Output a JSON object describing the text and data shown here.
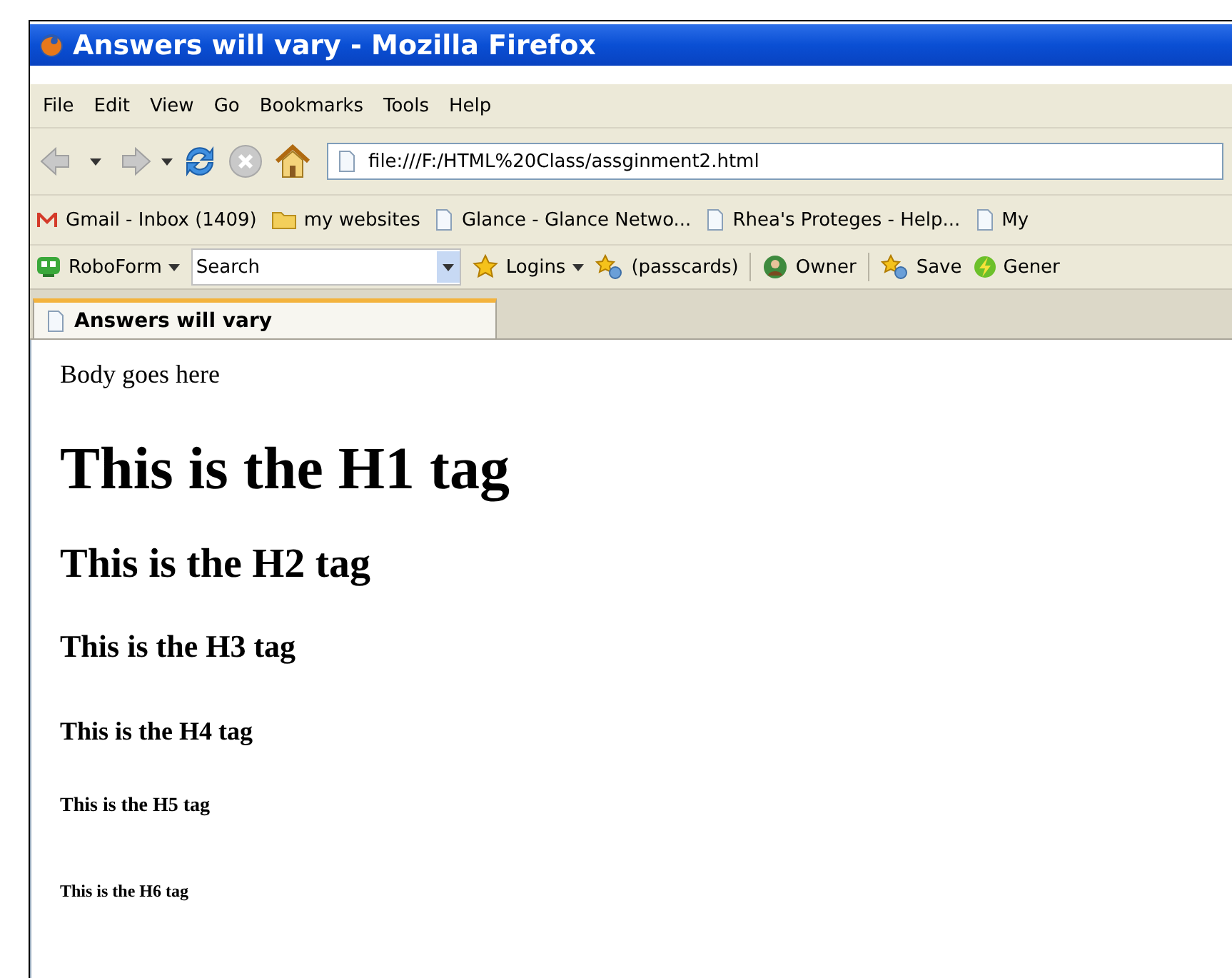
{
  "window": {
    "title": "Answers will vary - Mozilla Firefox"
  },
  "menu": [
    "File",
    "Edit",
    "View",
    "Go",
    "Bookmarks",
    "Tools",
    "Help"
  ],
  "address": {
    "value": "file:///F:/HTML%20Class/assginment2.html"
  },
  "bookmarks": [
    {
      "kind": "mail",
      "label": "Gmail - Inbox (1409)"
    },
    {
      "kind": "folder",
      "label": "my websites"
    },
    {
      "kind": "page",
      "label": "Glance - Glance Netwo..."
    },
    {
      "kind": "page",
      "label": "Rhea's Proteges - Help..."
    },
    {
      "kind": "page",
      "label": "My"
    }
  ],
  "roboform": [
    {
      "kind": "logo",
      "label": "RoboForm",
      "dropdown": true
    },
    {
      "kind": "search",
      "value": "Search"
    },
    {
      "kind": "star",
      "label": "Logins",
      "dropdown": true
    },
    {
      "kind": "stars",
      "label": "(passcards)",
      "dropdown": false
    },
    {
      "kind": "person",
      "label": "Owner",
      "dropdown": false
    },
    {
      "kind": "stars",
      "label": "Save",
      "dropdown": false
    },
    {
      "kind": "bolt",
      "label": "Gener",
      "dropdown": false
    }
  ],
  "tabs": [
    {
      "label": "Answers will vary",
      "selected": true
    }
  ],
  "content": [
    {
      "kind": "p",
      "text": "Body goes here"
    },
    {
      "kind": "h1",
      "text": "This is the H1 tag"
    },
    {
      "kind": "h2",
      "text": "This is the H2 tag"
    },
    {
      "kind": "h3",
      "text": "This is the H3 tag"
    },
    {
      "kind": "h4",
      "text": "This is the H4 tag"
    },
    {
      "kind": "h5",
      "text": "This is the H5 tag"
    },
    {
      "kind": "h6",
      "text": "This is the H6 tag"
    }
  ]
}
